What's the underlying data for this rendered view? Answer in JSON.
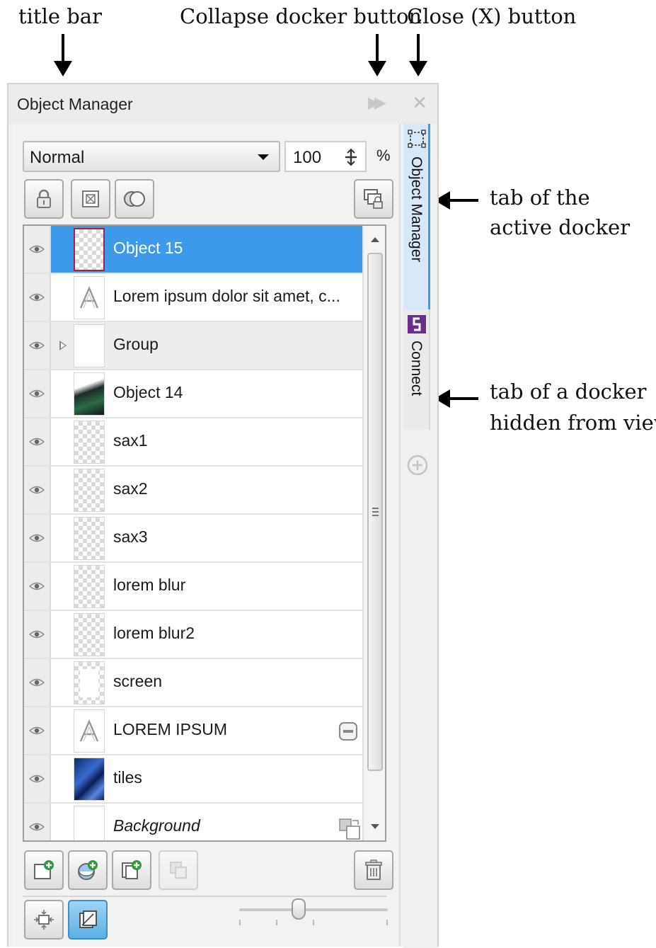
{
  "annotations": {
    "title_bar": "title bar",
    "collapse_docker": "Collapse docker button",
    "close_button": "Close (X) button",
    "active_tab_line1": "tab of the",
    "active_tab_line2": "active docker",
    "hidden_tab_line1": "tab of a docker",
    "hidden_tab_line2": "hidden from view"
  },
  "docker": {
    "title": "Object Manager",
    "collapse_glyph": "▶▶",
    "close_glyph": "✕",
    "blend_mode": "Normal",
    "opacity": "100",
    "opacity_unit": "%"
  },
  "layers": [
    {
      "label": "Object 15",
      "thumb": "checker",
      "selected": true
    },
    {
      "label": "Lorem ipsum dolor sit amet, c...",
      "thumb": "text"
    },
    {
      "label": "Group",
      "thumb": "blank",
      "expandable": true
    },
    {
      "label": "Object 14",
      "thumb": "photo"
    },
    {
      "label": "sax1",
      "thumb": "checker"
    },
    {
      "label": "sax2",
      "thumb": "checker"
    },
    {
      "label": "sax3",
      "thumb": "checker"
    },
    {
      "label": "lorem blur",
      "thumb": "checker"
    },
    {
      "label": "lorem blur2",
      "thumb": "checker"
    },
    {
      "label": "screen",
      "thumb": "screen"
    },
    {
      "label": "LOREM IPSUM",
      "thumb": "text",
      "badge": "minus"
    },
    {
      "label": "tiles",
      "thumb": "tiles"
    },
    {
      "label": "Background",
      "thumb": "blank",
      "badge": "pages",
      "italic": true
    }
  ],
  "tabs": {
    "active": "Object Manager",
    "hidden": "Connect"
  },
  "thumbnail_size_fraction": 0.4,
  "colors": {
    "selection": "#3d99ea",
    "selected_thumb_border": "#a3243b",
    "connect_icon": "#6b2d8c"
  }
}
